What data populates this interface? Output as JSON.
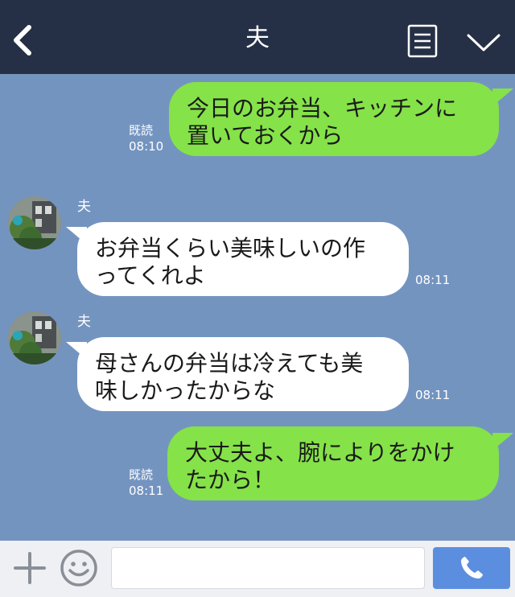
{
  "header": {
    "title": "夫",
    "back_icon": "chevron-left-icon",
    "notes_icon": "notes-icon",
    "menu_icon": "chevron-down-icon"
  },
  "messages": [
    {
      "side": "me",
      "text_lines": [
        "今日のお弁当、キッチンに",
        "置いておくから"
      ],
      "read": "既読",
      "time": "08:10"
    },
    {
      "side": "them",
      "sender": "夫",
      "text_lines": [
        "お弁当くらい美味しいの作",
        "ってくれよ"
      ],
      "time": "08:11"
    },
    {
      "side": "them",
      "sender": "夫",
      "text_lines": [
        "母さんの弁当は冷えても美",
        "味しかったからな"
      ],
      "time": "08:11"
    },
    {
      "side": "me",
      "text_lines": [
        "大丈夫よ、腕によりをかけ",
        "たから！"
      ],
      "read": "既読",
      "time": "08:11"
    }
  ],
  "footer": {
    "input_value": "",
    "input_placeholder": "",
    "plus_icon": "plus-icon",
    "smile_icon": "smile-icon",
    "send_icon": "phone-icon"
  },
  "colors": {
    "header_bg": "#253046",
    "chat_bg": "#7494c0",
    "my_bubble": "#85e249",
    "their_bubble": "#ffffff",
    "send_button": "#5c8ee0"
  }
}
